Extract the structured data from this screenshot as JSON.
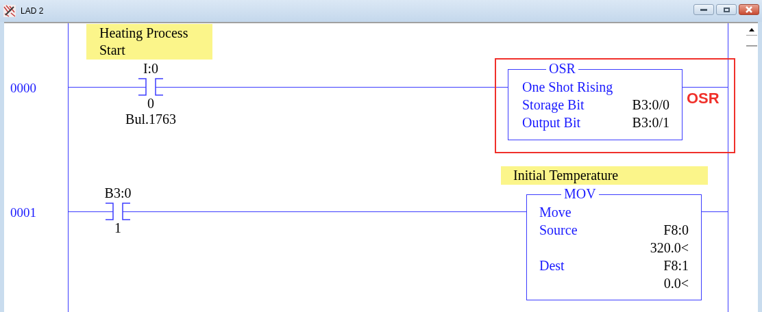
{
  "window": {
    "title": "LAD 2"
  },
  "rungs": [
    {
      "number": "0000",
      "comment": "Heating Process Start",
      "contact": {
        "address": "I:0",
        "bit": "0",
        "description": "Bul.1763"
      },
      "instruction": {
        "mnemonic": "OSR",
        "rows": [
          {
            "label": "One Shot Rising"
          },
          {
            "label": "Storage Bit",
            "value": "B3:0/0"
          },
          {
            "label": "Output Bit",
            "value": "B3:0/1"
          }
        ]
      },
      "highlight": {
        "text": "OSR"
      }
    },
    {
      "number": "0001",
      "comment": "Initial Temperature",
      "contact": {
        "address": "B3:0",
        "bit": "1"
      },
      "instruction": {
        "mnemonic": "MOV",
        "rows": [
          {
            "label": "Move"
          },
          {
            "label": "Source",
            "value": "F8:0"
          },
          {
            "value": "320.0<"
          },
          {
            "label": "Dest",
            "value": "F8:1"
          },
          {
            "value": "0.0<"
          }
        ]
      }
    }
  ]
}
